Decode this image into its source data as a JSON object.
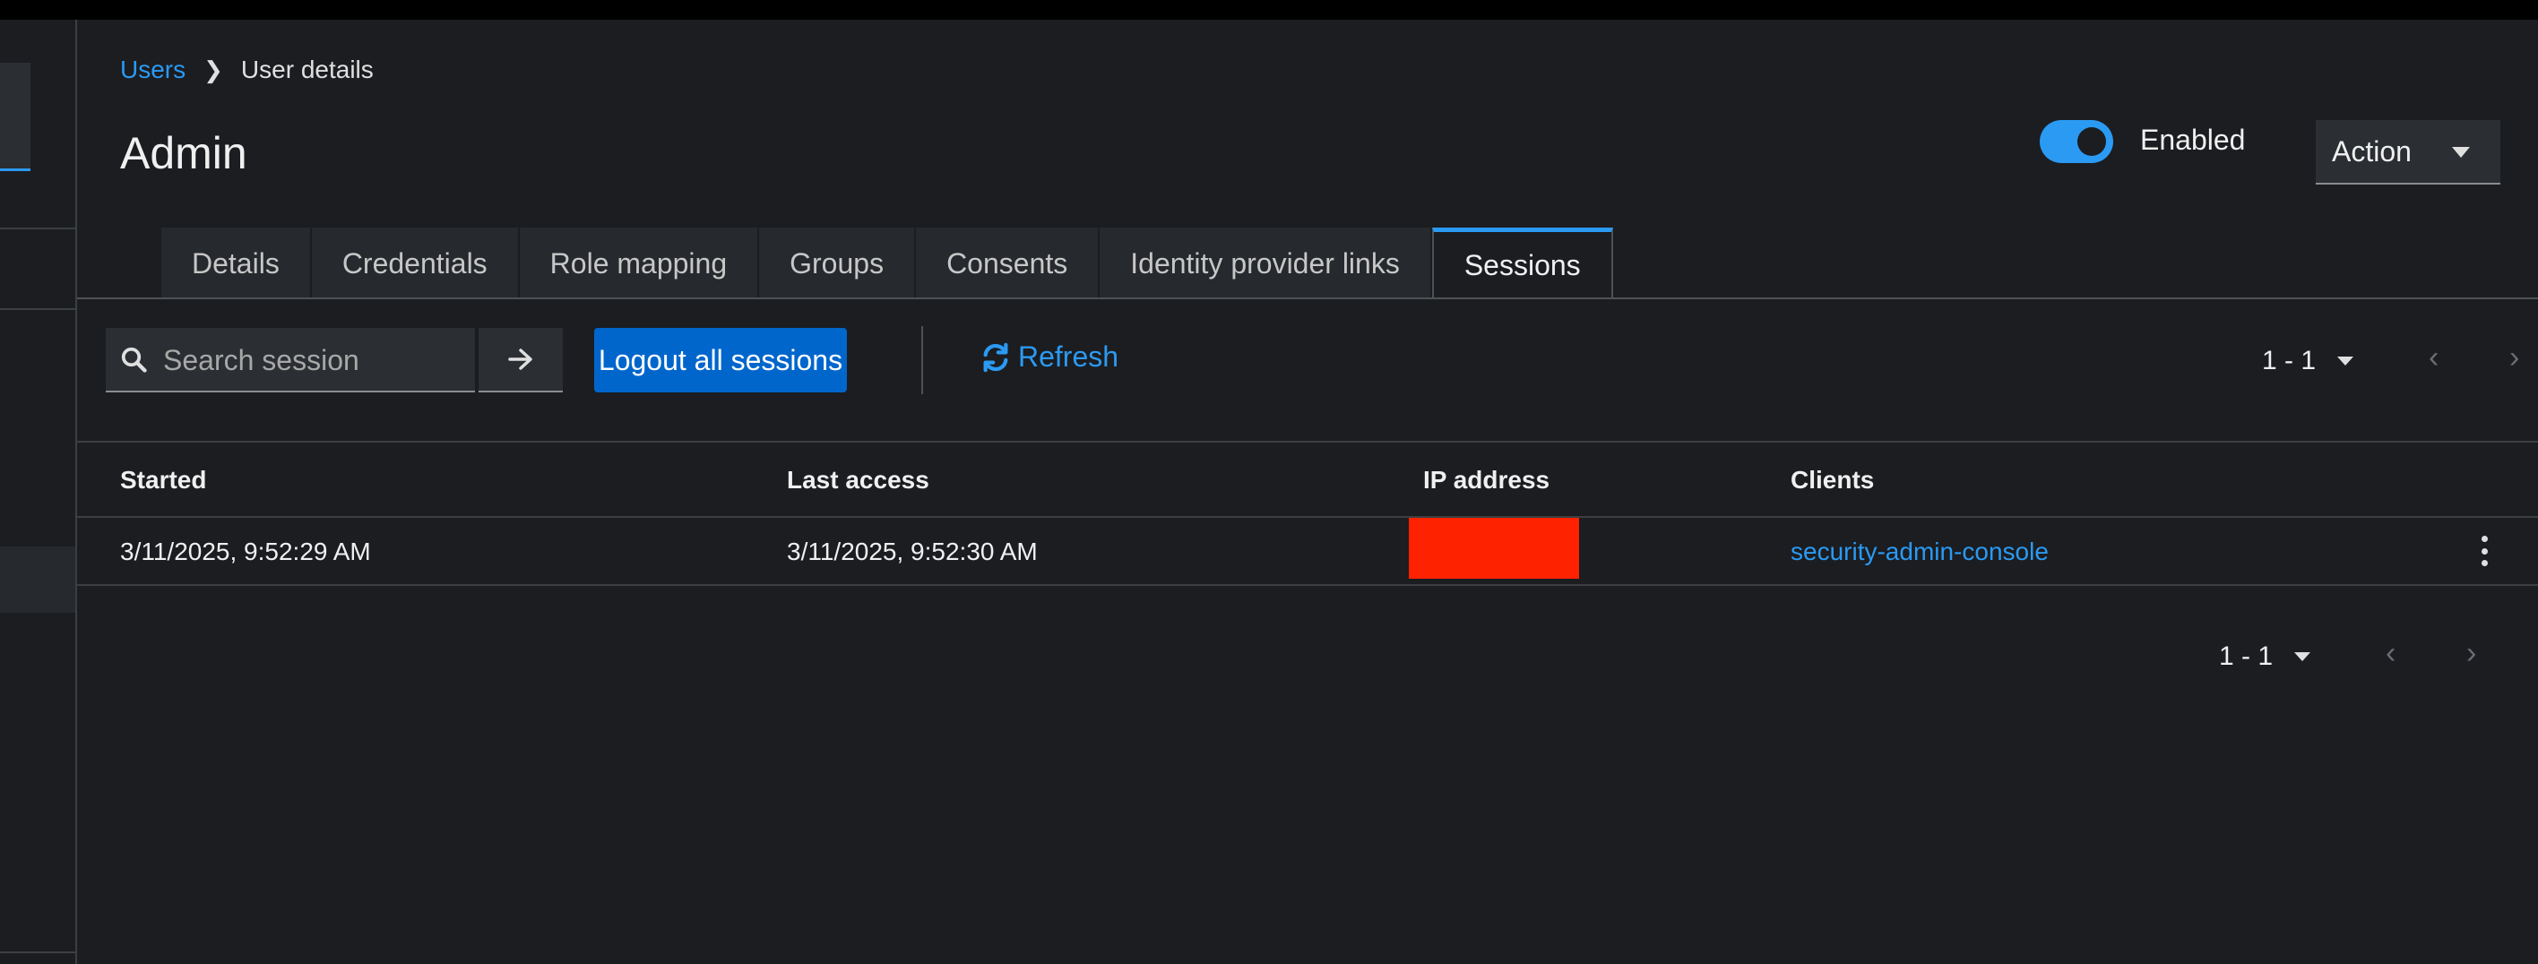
{
  "breadcrumb": {
    "parent": "Users",
    "current": "User details"
  },
  "page": {
    "title": "Admin"
  },
  "status": {
    "toggle_label": "Enabled",
    "enabled": true
  },
  "action": {
    "label": "Action"
  },
  "tabs": [
    {
      "label": "Details"
    },
    {
      "label": "Credentials"
    },
    {
      "label": "Role mapping"
    },
    {
      "label": "Groups"
    },
    {
      "label": "Consents"
    },
    {
      "label": "Identity provider links"
    },
    {
      "label": "Sessions",
      "active": true
    }
  ],
  "toolbar": {
    "search_placeholder": "Search session",
    "logout_label": "Logout all sessions",
    "refresh_label": "Refresh"
  },
  "pagination": {
    "range": "1 - 1"
  },
  "table": {
    "columns": [
      "Started",
      "Last access",
      "IP address",
      "Clients"
    ],
    "rows": [
      {
        "started": "3/11/2025, 9:52:29 AM",
        "last_access": "3/11/2025, 9:52:30 AM",
        "ip": "",
        "client": "security-admin-console"
      }
    ]
  },
  "icons": {
    "search": "search-icon",
    "arrow": "arrow-right-icon",
    "refresh": "refresh-icon",
    "kebab": "kebab-icon",
    "caret": "caret-down-icon",
    "chevron_left": "chevron-left-icon",
    "chevron_right": "chevron-right-icon"
  },
  "colors": {
    "accent": "#2b9af3",
    "primary_button": "#0066cc",
    "redaction": "#ff2200",
    "background": "#1b1d21"
  }
}
